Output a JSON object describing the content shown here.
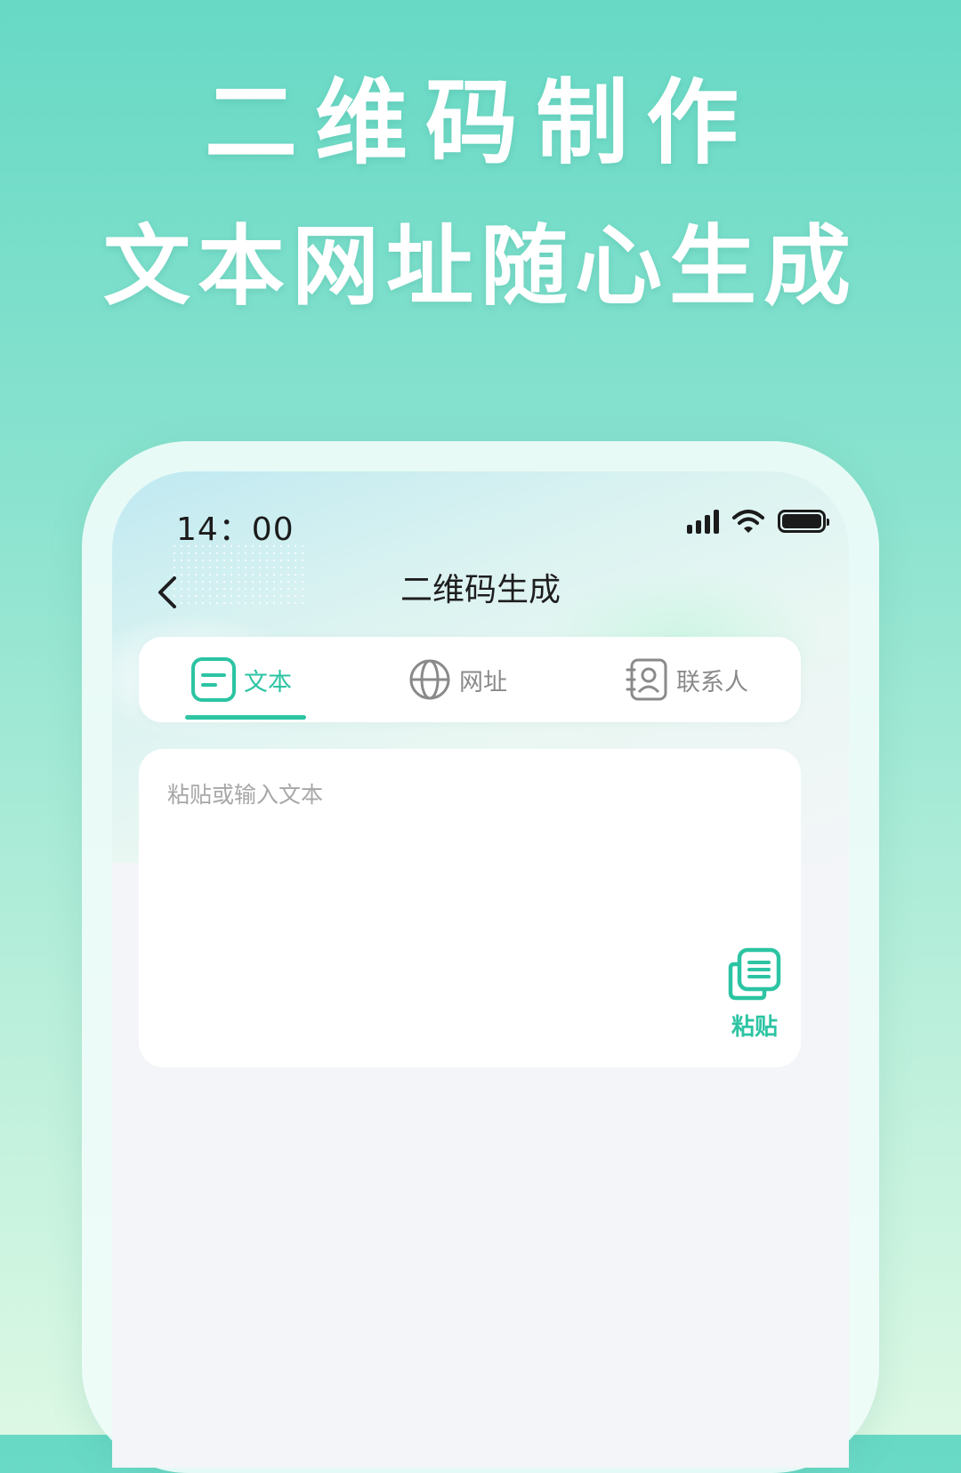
{
  "promo": {
    "line1": "二维码制作",
    "line2": "文本网址随心生成"
  },
  "status_bar": {
    "time": "14：00",
    "icons": [
      "signal-icon",
      "wifi-icon",
      "battery-icon"
    ]
  },
  "header": {
    "back_icon": "chevron-left-icon",
    "title": "二维码生成"
  },
  "tabs": [
    {
      "label": "文本",
      "icon": "text-icon",
      "active": true
    },
    {
      "label": "网址",
      "icon": "globe-icon",
      "active": false
    },
    {
      "label": "联系人",
      "icon": "contact-icon",
      "active": false
    }
  ],
  "input": {
    "placeholder": "粘贴或输入文本",
    "value": ""
  },
  "paste": {
    "label": "粘贴",
    "icon": "copy-icon"
  },
  "colors": {
    "accent": "#2cc4a3",
    "background_top": "#67d9c5",
    "screen_bg": "#f3f5f8"
  }
}
